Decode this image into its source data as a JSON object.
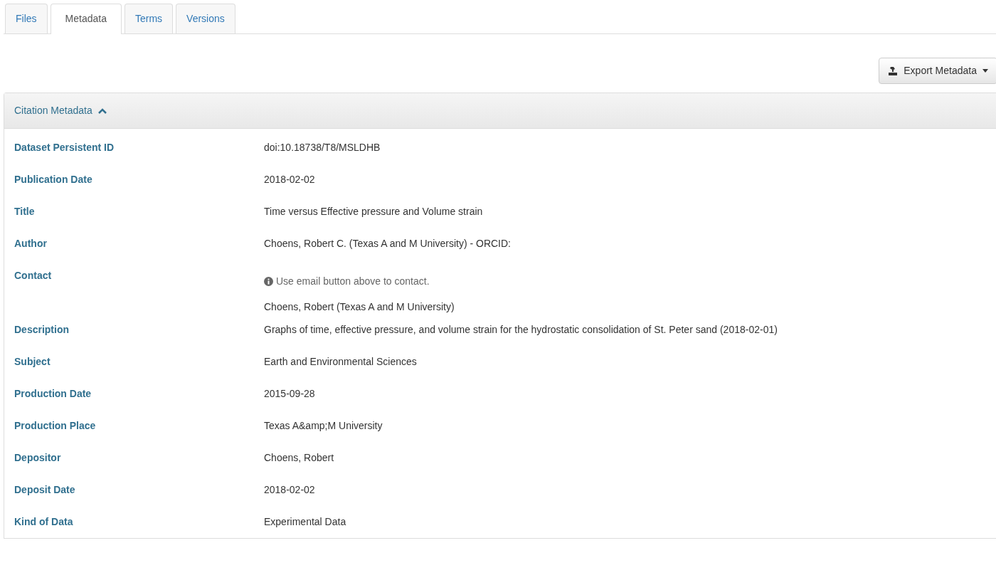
{
  "tabs": [
    {
      "label": "Files",
      "selected": false
    },
    {
      "label": "Metadata",
      "selected": true
    },
    {
      "label": "Terms",
      "selected": false
    },
    {
      "label": "Versions",
      "selected": false
    }
  ],
  "export_button": {
    "label": "Export Metadata"
  },
  "panel": {
    "title": "Citation Metadata",
    "expanded": true,
    "rows": [
      {
        "label": "Dataset Persistent ID",
        "values": [
          "doi:10.18738/T8/MSLDHB"
        ]
      },
      {
        "label": "Publication Date",
        "values": [
          "2018-02-02"
        ]
      },
      {
        "label": "Title",
        "values": [
          "Time versus Effective pressure and Volume strain"
        ]
      },
      {
        "label": "Author",
        "values": [
          "Choens, Robert C. (Texas A and M University) - ORCID:"
        ]
      },
      {
        "label": "Contact",
        "note": "Use email button above to contact.",
        "values": [
          "Choens, Robert (Texas A and M University)"
        ]
      },
      {
        "label": "Description",
        "values": [
          "Graphs of time, effective pressure, and volume strain for the hydrostatic consolidation of St. Peter sand (2018-02-01)"
        ]
      },
      {
        "label": "Subject",
        "values": [
          "Earth and Environmental Sciences"
        ]
      },
      {
        "label": "Production Date",
        "values": [
          "2015-09-28"
        ]
      },
      {
        "label": "Production Place",
        "values": [
          "Texas A&amp;M University"
        ]
      },
      {
        "label": "Depositor",
        "values": [
          "Choens, Robert"
        ]
      },
      {
        "label": "Deposit Date",
        "values": [
          "2018-02-02"
        ]
      },
      {
        "label": "Kind of Data",
        "values": [
          "Experimental Data"
        ]
      }
    ]
  }
}
